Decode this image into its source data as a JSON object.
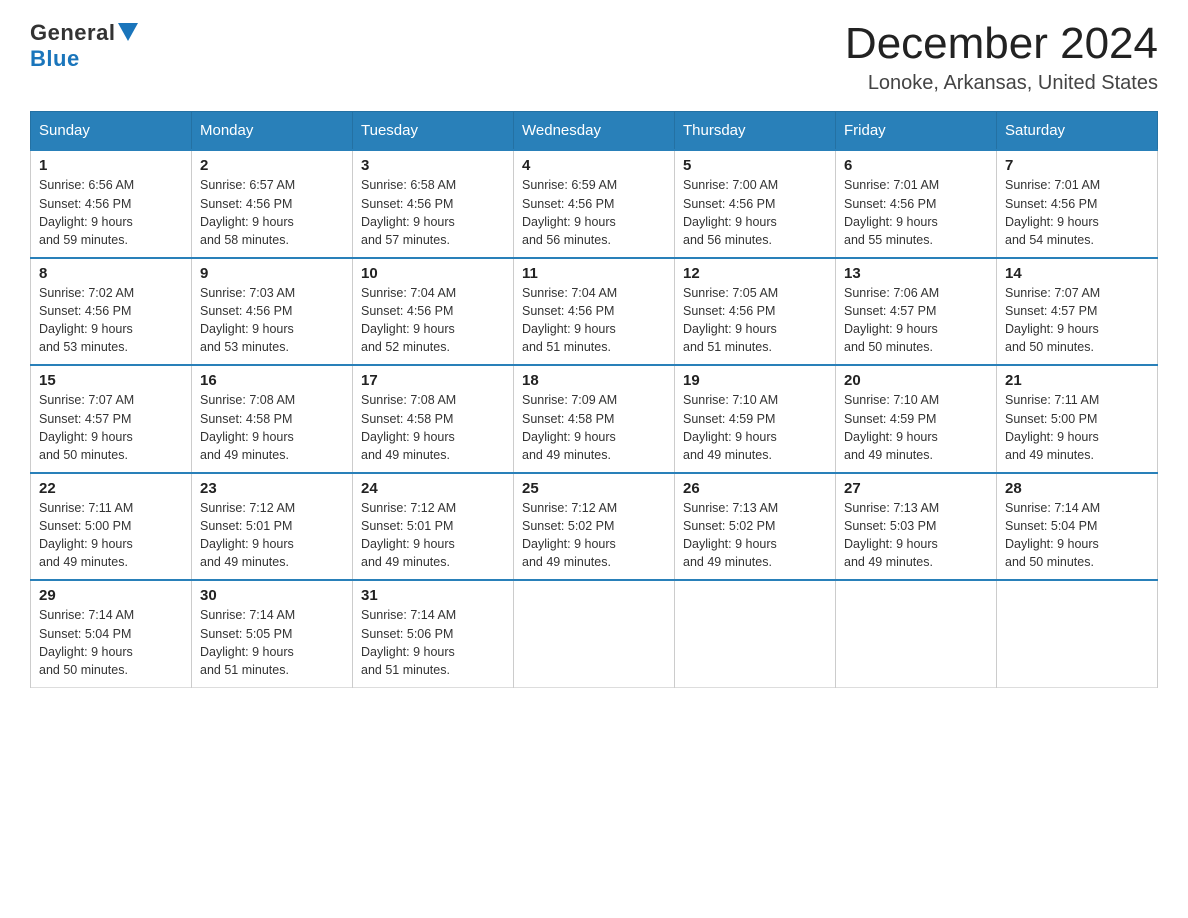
{
  "logo": {
    "general": "General",
    "blue": "Blue"
  },
  "title": "December 2024",
  "location": "Lonoke, Arkansas, United States",
  "weekdays": [
    "Sunday",
    "Monday",
    "Tuesday",
    "Wednesday",
    "Thursday",
    "Friday",
    "Saturday"
  ],
  "weeks": [
    [
      {
        "day": "1",
        "info": "Sunrise: 6:56 AM\nSunset: 4:56 PM\nDaylight: 9 hours\nand 59 minutes."
      },
      {
        "day": "2",
        "info": "Sunrise: 6:57 AM\nSunset: 4:56 PM\nDaylight: 9 hours\nand 58 minutes."
      },
      {
        "day": "3",
        "info": "Sunrise: 6:58 AM\nSunset: 4:56 PM\nDaylight: 9 hours\nand 57 minutes."
      },
      {
        "day": "4",
        "info": "Sunrise: 6:59 AM\nSunset: 4:56 PM\nDaylight: 9 hours\nand 56 minutes."
      },
      {
        "day": "5",
        "info": "Sunrise: 7:00 AM\nSunset: 4:56 PM\nDaylight: 9 hours\nand 56 minutes."
      },
      {
        "day": "6",
        "info": "Sunrise: 7:01 AM\nSunset: 4:56 PM\nDaylight: 9 hours\nand 55 minutes."
      },
      {
        "day": "7",
        "info": "Sunrise: 7:01 AM\nSunset: 4:56 PM\nDaylight: 9 hours\nand 54 minutes."
      }
    ],
    [
      {
        "day": "8",
        "info": "Sunrise: 7:02 AM\nSunset: 4:56 PM\nDaylight: 9 hours\nand 53 minutes."
      },
      {
        "day": "9",
        "info": "Sunrise: 7:03 AM\nSunset: 4:56 PM\nDaylight: 9 hours\nand 53 minutes."
      },
      {
        "day": "10",
        "info": "Sunrise: 7:04 AM\nSunset: 4:56 PM\nDaylight: 9 hours\nand 52 minutes."
      },
      {
        "day": "11",
        "info": "Sunrise: 7:04 AM\nSunset: 4:56 PM\nDaylight: 9 hours\nand 51 minutes."
      },
      {
        "day": "12",
        "info": "Sunrise: 7:05 AM\nSunset: 4:56 PM\nDaylight: 9 hours\nand 51 minutes."
      },
      {
        "day": "13",
        "info": "Sunrise: 7:06 AM\nSunset: 4:57 PM\nDaylight: 9 hours\nand 50 minutes."
      },
      {
        "day": "14",
        "info": "Sunrise: 7:07 AM\nSunset: 4:57 PM\nDaylight: 9 hours\nand 50 minutes."
      }
    ],
    [
      {
        "day": "15",
        "info": "Sunrise: 7:07 AM\nSunset: 4:57 PM\nDaylight: 9 hours\nand 50 minutes."
      },
      {
        "day": "16",
        "info": "Sunrise: 7:08 AM\nSunset: 4:58 PM\nDaylight: 9 hours\nand 49 minutes."
      },
      {
        "day": "17",
        "info": "Sunrise: 7:08 AM\nSunset: 4:58 PM\nDaylight: 9 hours\nand 49 minutes."
      },
      {
        "day": "18",
        "info": "Sunrise: 7:09 AM\nSunset: 4:58 PM\nDaylight: 9 hours\nand 49 minutes."
      },
      {
        "day": "19",
        "info": "Sunrise: 7:10 AM\nSunset: 4:59 PM\nDaylight: 9 hours\nand 49 minutes."
      },
      {
        "day": "20",
        "info": "Sunrise: 7:10 AM\nSunset: 4:59 PM\nDaylight: 9 hours\nand 49 minutes."
      },
      {
        "day": "21",
        "info": "Sunrise: 7:11 AM\nSunset: 5:00 PM\nDaylight: 9 hours\nand 49 minutes."
      }
    ],
    [
      {
        "day": "22",
        "info": "Sunrise: 7:11 AM\nSunset: 5:00 PM\nDaylight: 9 hours\nand 49 minutes."
      },
      {
        "day": "23",
        "info": "Sunrise: 7:12 AM\nSunset: 5:01 PM\nDaylight: 9 hours\nand 49 minutes."
      },
      {
        "day": "24",
        "info": "Sunrise: 7:12 AM\nSunset: 5:01 PM\nDaylight: 9 hours\nand 49 minutes."
      },
      {
        "day": "25",
        "info": "Sunrise: 7:12 AM\nSunset: 5:02 PM\nDaylight: 9 hours\nand 49 minutes."
      },
      {
        "day": "26",
        "info": "Sunrise: 7:13 AM\nSunset: 5:02 PM\nDaylight: 9 hours\nand 49 minutes."
      },
      {
        "day": "27",
        "info": "Sunrise: 7:13 AM\nSunset: 5:03 PM\nDaylight: 9 hours\nand 49 minutes."
      },
      {
        "day": "28",
        "info": "Sunrise: 7:14 AM\nSunset: 5:04 PM\nDaylight: 9 hours\nand 50 minutes."
      }
    ],
    [
      {
        "day": "29",
        "info": "Sunrise: 7:14 AM\nSunset: 5:04 PM\nDaylight: 9 hours\nand 50 minutes."
      },
      {
        "day": "30",
        "info": "Sunrise: 7:14 AM\nSunset: 5:05 PM\nDaylight: 9 hours\nand 51 minutes."
      },
      {
        "day": "31",
        "info": "Sunrise: 7:14 AM\nSunset: 5:06 PM\nDaylight: 9 hours\nand 51 minutes."
      },
      {
        "day": "",
        "info": ""
      },
      {
        "day": "",
        "info": ""
      },
      {
        "day": "",
        "info": ""
      },
      {
        "day": "",
        "info": ""
      }
    ]
  ]
}
